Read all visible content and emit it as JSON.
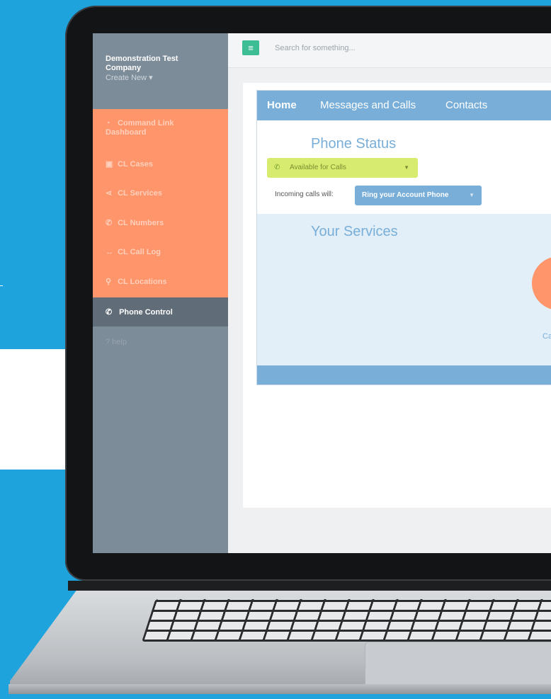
{
  "sidebar": {
    "company_name": "Demonstration Test Company",
    "create_new": "Create New ▾",
    "items": [
      {
        "icon": "dashboard-icon",
        "glyph": "◔",
        "label": "Command Link Dashboard"
      },
      {
        "icon": "briefcase-icon",
        "glyph": "▣",
        "label": "CL Cases"
      },
      {
        "icon": "share-icon",
        "glyph": "⋖",
        "label": "CL Services"
      },
      {
        "icon": "phone-icon",
        "glyph": "✆",
        "label": "CL Numbers"
      },
      {
        "icon": "arrows-icon",
        "glyph": "↔",
        "label": "CL Call Log"
      },
      {
        "icon": "location-pin-icon",
        "glyph": "⚲",
        "label": "CL Locations"
      }
    ],
    "active_item": {
      "icon": "phone-icon",
      "glyph": "✆",
      "label": "Phone Control"
    },
    "help": "? help"
  },
  "topbar": {
    "menu_glyph": "≡",
    "search_placeholder": "Search for something..."
  },
  "main": {
    "tabs": [
      {
        "label": "Home",
        "active": true
      },
      {
        "label": "Messages and Calls",
        "active": false
      },
      {
        "label": "Contacts",
        "active": false
      }
    ],
    "phone_status_title": "Phone Status",
    "availability": {
      "glyph": "✆",
      "label": "Available for Calls",
      "caret": "▼"
    },
    "incoming_label": "Incoming calls will:",
    "ring_option": {
      "label": "Ring your Account Phone",
      "caret": "▼"
    },
    "services_title": "Your Services",
    "service_label_partial": "Ca"
  },
  "colors": {
    "background": "#1fa3dc",
    "sidebar": "#7d8c99",
    "sidebar_accent": "#ff956a",
    "active_item": "#606d79",
    "menu_button": "#3dbd93",
    "blue_accent": "#78aed8",
    "availability": "#d7ec6e"
  }
}
